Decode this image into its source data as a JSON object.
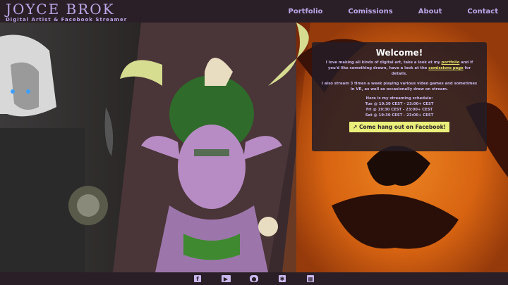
{
  "brand": {
    "title": "JOYCE BROK",
    "subtitle": "Digital Artist & Facebook Streamer"
  },
  "nav": {
    "items": [
      "Portfolio",
      "Comissions",
      "About",
      "Contact"
    ]
  },
  "welcome": {
    "title": "Welcome!",
    "p1_a": "I love making all kinds of digital art, take a look at my ",
    "portfolio_link": "portfolio",
    "p1_b": " and if you'd like something drawn, have a look at the ",
    "comissions_link": "comissions page",
    "p1_c": " for details.",
    "p2": "I also stream 3 times a week playing various video games and sometimes in VR, as well as occasionally draw on stream.",
    "schedule_head": "Here is my streaming schedule:",
    "schedule": [
      "Tue @ 19:30 CEST - 23:00+ CEST",
      "Fri @ 19:30 CEST - 23:00+ CEST",
      "Sat @ 19:30 CEST - 23:00+ CEST"
    ],
    "cta": "Come hang out on Facebook!",
    "cta_icon": "external-link-icon"
  },
  "footer": {
    "icons": [
      "facebook-icon",
      "youtube-icon",
      "discord-icon",
      "twitter-icon",
      "trello-icon"
    ]
  },
  "colors": {
    "accent": "#b9a7e8",
    "highlight": "#e9ef7a",
    "background": "#2a1f27"
  }
}
